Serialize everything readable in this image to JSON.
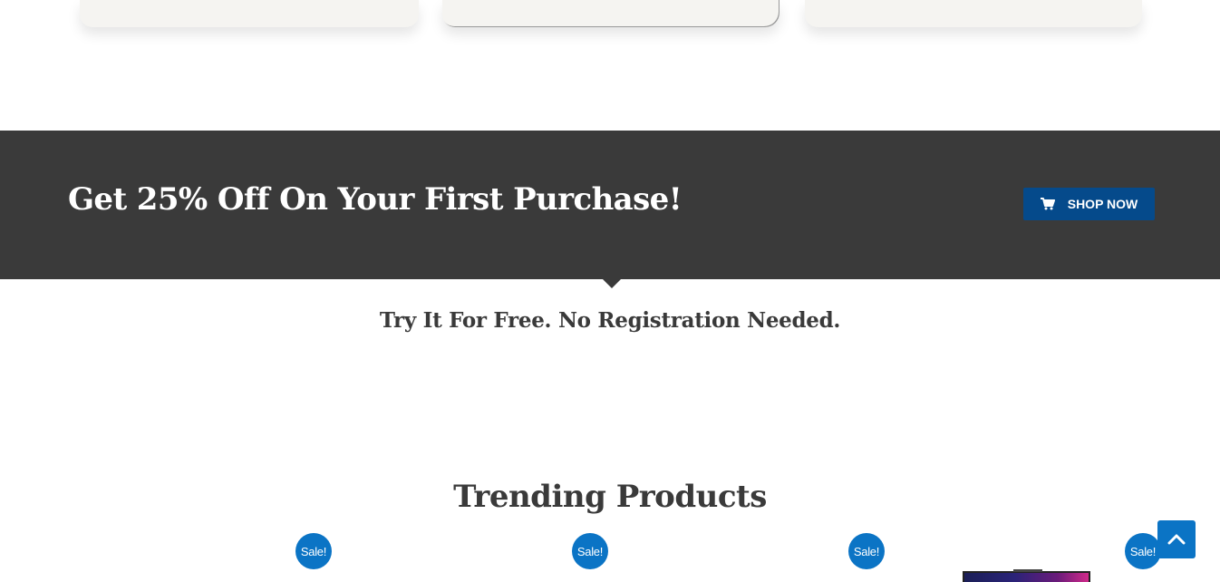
{
  "promo": {
    "title": "Get 25% Off On Your First Purchase!",
    "button_label": "SHOP NOW",
    "button_icon": "cart-icon",
    "subheading": "Try It For Free. No Registration Needed."
  },
  "trending": {
    "title": "Trending Products",
    "badges": [
      "Sale!",
      "Sale!",
      "Sale!",
      "Sale!"
    ]
  },
  "scroll_top": {
    "icon": "chevron-up-icon"
  },
  "colors": {
    "banner_bg": "#3a3a3a",
    "button_bg": "#054a8b",
    "accent": "#0b74c5",
    "card_bg": "#f5f4f1"
  }
}
